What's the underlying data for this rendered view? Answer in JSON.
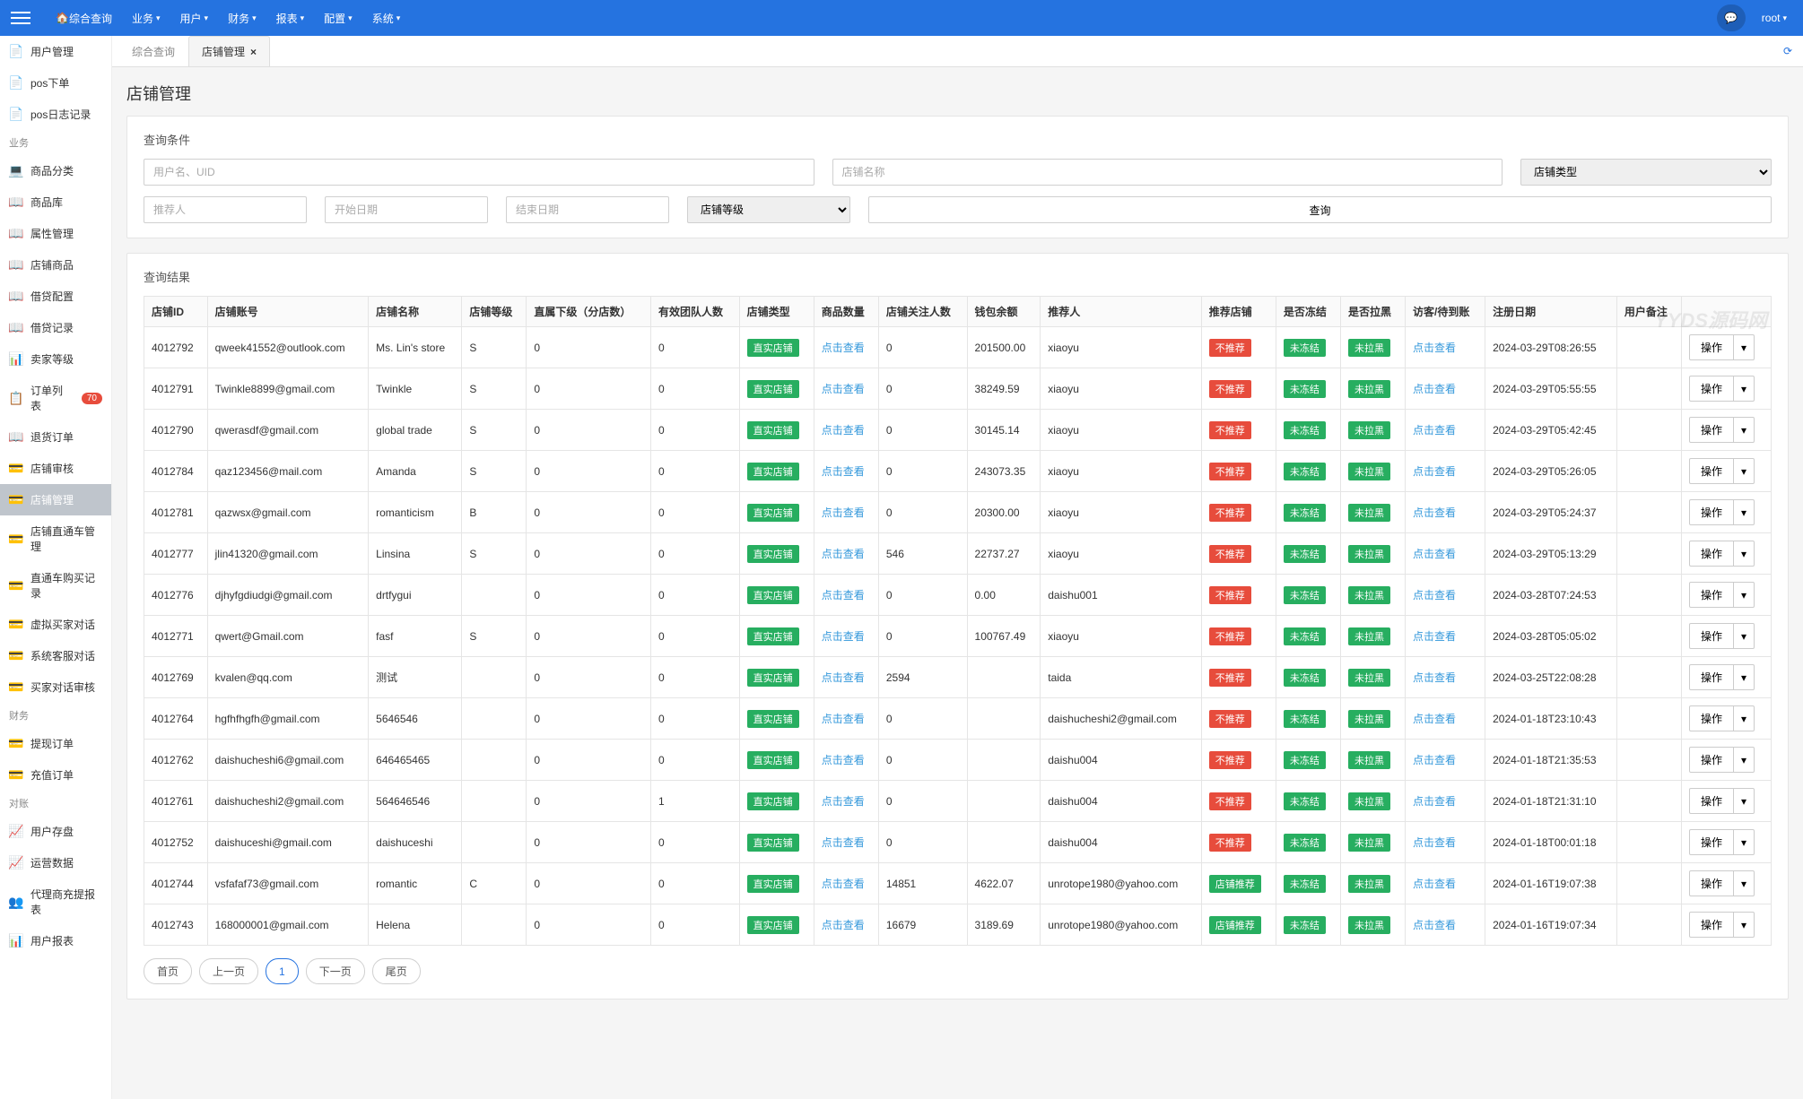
{
  "topnav": {
    "home": "综合查询",
    "items": [
      "业务",
      "用户",
      "财务",
      "报表",
      "配置",
      "系统"
    ],
    "user": "root"
  },
  "sidebar": {
    "items": [
      {
        "icon": "📄",
        "label": "用户管理"
      },
      {
        "icon": "📄",
        "label": "pos下单"
      },
      {
        "icon": "📄",
        "label": "pos日志记录"
      }
    ],
    "group1_label": "业务",
    "group1": [
      {
        "icon": "💻",
        "label": "商品分类"
      },
      {
        "icon": "📖",
        "label": "商品库"
      },
      {
        "icon": "📖",
        "label": "属性管理"
      },
      {
        "icon": "📖",
        "label": "店铺商品"
      },
      {
        "icon": "📖",
        "label": "借贷配置"
      },
      {
        "icon": "📖",
        "label": "借贷记录"
      },
      {
        "icon": "📊",
        "label": "卖家等级"
      },
      {
        "icon": "📋",
        "label": "订单列表",
        "badge": "70"
      },
      {
        "icon": "📖",
        "label": "退货订单"
      },
      {
        "icon": "💳",
        "label": "店铺审核"
      },
      {
        "icon": "💳",
        "label": "店铺管理",
        "active": true
      },
      {
        "icon": "💳",
        "label": "店铺直通车管理"
      },
      {
        "icon": "💳",
        "label": "直通车购买记录"
      },
      {
        "icon": "💳",
        "label": "虚拟买家对话"
      },
      {
        "icon": "💳",
        "label": "系统客服对话"
      },
      {
        "icon": "💳",
        "label": "买家对话审核"
      }
    ],
    "group2_label": "财务",
    "group2": [
      {
        "icon": "💳",
        "label": "提现订单"
      },
      {
        "icon": "💳",
        "label": "充值订单"
      }
    ],
    "group3_label": "对账",
    "group3": [
      {
        "icon": "📈",
        "label": "用户存盘"
      },
      {
        "icon": "📈",
        "label": "运营数据"
      },
      {
        "icon": "👥",
        "label": "代理商充提报表"
      },
      {
        "icon": "📊",
        "label": "用户报表"
      }
    ]
  },
  "tabs": {
    "inactive": "综合查询",
    "active": "店铺管理"
  },
  "page_title": "店铺管理",
  "filters": {
    "title": "查询条件",
    "ph_user": "用户名、UID",
    "ph_store": "店铺名称",
    "ph_type": "店铺类型",
    "ph_referrer": "推荐人",
    "ph_start": "开始日期",
    "ph_end": "结束日期",
    "ph_level": "店铺等级",
    "btn_query": "查询"
  },
  "results": {
    "title": "查询结果",
    "columns": [
      "店铺ID",
      "店铺账号",
      "店铺名称",
      "店铺等级",
      "直属下级（分店数）",
      "有效团队人数",
      "店铺类型",
      "商品数量",
      "店铺关注人数",
      "钱包余额",
      "推荐人",
      "推荐店铺",
      "是否冻结",
      "是否拉黑",
      "访客/待到账",
      "注册日期",
      "用户备注",
      ""
    ],
    "type_label": "直实店铺",
    "click_view": "点击查看",
    "no_rec": "不推荐",
    "rec": "店铺推荐",
    "not_frozen": "未冻结",
    "not_black": "未拉黑",
    "op_label": "操作",
    "rows": [
      {
        "id": "4012792",
        "acct": "qweek41552@outlook.com",
        "name": "Ms. Lin's store",
        "level": "S",
        "sub": "0",
        "team": "0",
        "goods": "",
        "follow": "0",
        "wallet": "201500.00",
        "ref": "xiaoyu",
        "rec": false,
        "date": "2024-03-29T08:26:55"
      },
      {
        "id": "4012791",
        "acct": "Twinkle8899@gmail.com",
        "name": "Twinkle",
        "level": "S",
        "sub": "0",
        "team": "0",
        "goods": "",
        "follow": "0",
        "wallet": "38249.59",
        "ref": "xiaoyu",
        "rec": false,
        "date": "2024-03-29T05:55:55"
      },
      {
        "id": "4012790",
        "acct": "qwerasdf@gmail.com",
        "name": "global trade",
        "level": "S",
        "sub": "0",
        "team": "0",
        "goods": "",
        "follow": "0",
        "wallet": "30145.14",
        "ref": "xiaoyu",
        "rec": false,
        "date": "2024-03-29T05:42:45"
      },
      {
        "id": "4012784",
        "acct": "qaz123456@mail.com",
        "name": "Amanda",
        "level": "S",
        "sub": "0",
        "team": "0",
        "goods": "",
        "follow": "0",
        "wallet": "243073.35",
        "ref": "xiaoyu",
        "rec": false,
        "date": "2024-03-29T05:26:05"
      },
      {
        "id": "4012781",
        "acct": "qazwsx@gmail.com",
        "name": "romanticism",
        "level": "B",
        "sub": "0",
        "team": "0",
        "goods": "",
        "follow": "0",
        "wallet": "20300.00",
        "ref": "xiaoyu",
        "rec": false,
        "date": "2024-03-29T05:24:37"
      },
      {
        "id": "4012777",
        "acct": "jlin41320@gmail.com",
        "name": "Linsina",
        "level": "S",
        "sub": "0",
        "team": "0",
        "goods": "",
        "follow": "546",
        "wallet": "22737.27",
        "ref": "xiaoyu",
        "rec": false,
        "date": "2024-03-29T05:13:29"
      },
      {
        "id": "4012776",
        "acct": "djhyfgdiudgi@gmail.com",
        "name": "drtfygui",
        "level": "",
        "sub": "0",
        "team": "0",
        "goods": "",
        "follow": "0",
        "wallet": "0.00",
        "ref": "daishu001",
        "rec": false,
        "date": "2024-03-28T07:24:53"
      },
      {
        "id": "4012771",
        "acct": "qwert@Gmail.com",
        "name": "fasf",
        "level": "S",
        "sub": "0",
        "team": "0",
        "goods": "",
        "follow": "0",
        "wallet": "100767.49",
        "ref": "xiaoyu",
        "rec": false,
        "date": "2024-03-28T05:05:02"
      },
      {
        "id": "4012769",
        "acct": "kvalen@qq.com",
        "name": "测试",
        "level": "",
        "sub": "0",
        "team": "0",
        "goods": "",
        "follow": "2594",
        "wallet": "",
        "ref": "taida",
        "rec": false,
        "date": "2024-03-25T22:08:28"
      },
      {
        "id": "4012764",
        "acct": "hgfhfhgfh@gmail.com",
        "name": "5646546",
        "level": "",
        "sub": "0",
        "team": "0",
        "goods": "",
        "follow": "0",
        "wallet": "",
        "ref": "daishucheshi2@gmail.com",
        "rec": false,
        "date": "2024-01-18T23:10:43"
      },
      {
        "id": "4012762",
        "acct": "daishucheshi6@gmail.com",
        "name": "646465465",
        "level": "",
        "sub": "0",
        "team": "0",
        "goods": "",
        "follow": "0",
        "wallet": "",
        "ref": "daishu004",
        "rec": false,
        "date": "2024-01-18T21:35:53"
      },
      {
        "id": "4012761",
        "acct": "daishucheshi2@gmail.com",
        "name": "564646546",
        "level": "",
        "sub": "0",
        "team": "1",
        "goods": "",
        "follow": "0",
        "wallet": "",
        "ref": "daishu004",
        "rec": false,
        "date": "2024-01-18T21:31:10"
      },
      {
        "id": "4012752",
        "acct": "daishuceshi@gmail.com",
        "name": "daishuceshi",
        "level": "",
        "sub": "0",
        "team": "0",
        "goods": "",
        "follow": "0",
        "wallet": "",
        "ref": "daishu004",
        "rec": false,
        "date": "2024-01-18T00:01:18"
      },
      {
        "id": "4012744",
        "acct": "vsfafaf73@gmail.com",
        "name": "romantic",
        "level": "C",
        "sub": "0",
        "team": "0",
        "goods": "",
        "follow": "14851",
        "wallet": "4622.07",
        "ref": "unrotope1980@yahoo.com",
        "rec": true,
        "date": "2024-01-16T19:07:38"
      },
      {
        "id": "4012743",
        "acct": "168000001@gmail.com",
        "name": "Helena",
        "level": "",
        "sub": "0",
        "team": "0",
        "goods": "",
        "follow": "16679",
        "wallet": "3189.69",
        "ref": "unrotope1980@yahoo.com",
        "rec": true,
        "date": "2024-01-16T19:07:34"
      }
    ]
  },
  "pager": {
    "first": "首页",
    "prev": "上一页",
    "cur": "1",
    "next": "下一页",
    "last": "尾页"
  },
  "watermark": "YYDS源码网"
}
